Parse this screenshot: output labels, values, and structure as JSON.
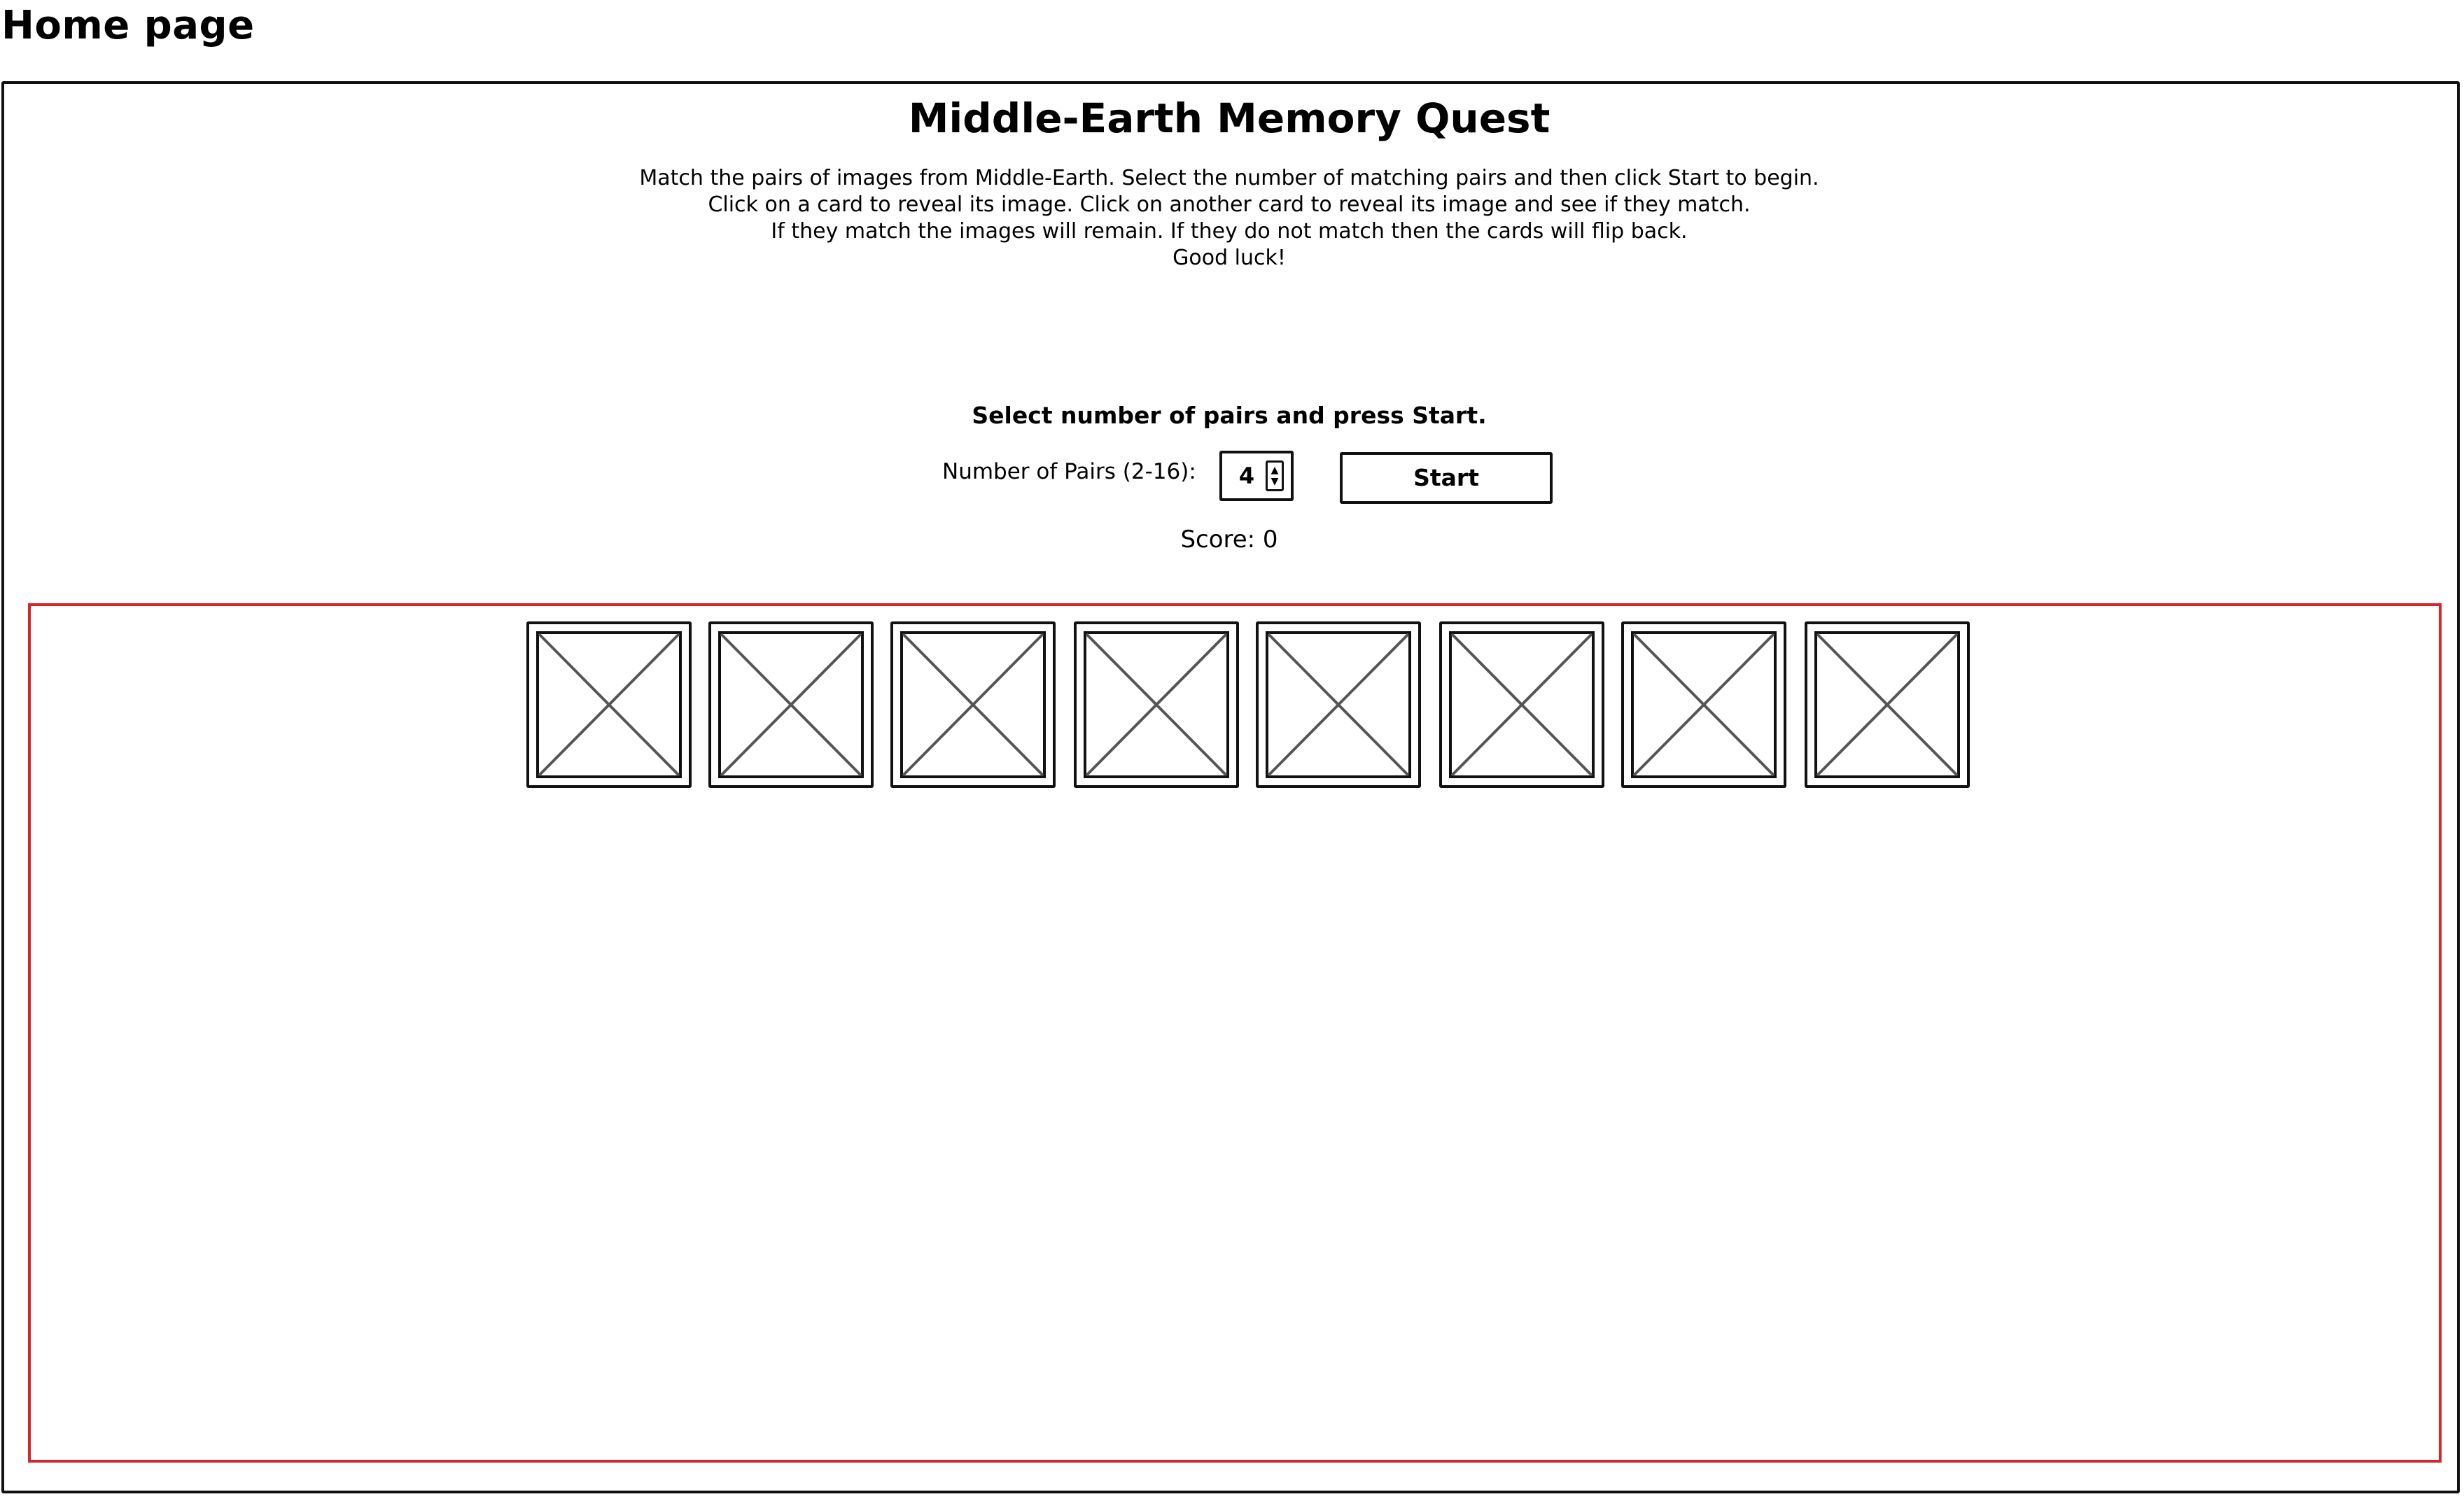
{
  "page_label": "Home page",
  "game": {
    "title": "Middle-Earth Memory Quest",
    "instructions": [
      "Match the pairs of images from Middle-Earth. Select the number of matching pairs and then click Start to begin.",
      "Click on a card to reveal its image. Click on another card to reveal its image and see if they match.",
      "If they match the images will remain. If they do not match then the cards will flip back.",
      "Good luck!"
    ],
    "prompt": "Select number of pairs and press Start.",
    "pairs_label": "Number of Pairs (2-16):",
    "pairs_value": "4",
    "start_label": "Start",
    "score_text": "Score: 0"
  },
  "cards": [
    {
      "icon": "image-placeholder-icon"
    },
    {
      "icon": "image-placeholder-icon"
    },
    {
      "icon": "image-placeholder-icon"
    },
    {
      "icon": "image-placeholder-icon"
    },
    {
      "icon": "image-placeholder-icon"
    },
    {
      "icon": "image-placeholder-icon"
    },
    {
      "icon": "image-placeholder-icon"
    },
    {
      "icon": "image-placeholder-icon"
    }
  ],
  "colors": {
    "board_border": "#d6252b",
    "frame_border": "#111111"
  }
}
